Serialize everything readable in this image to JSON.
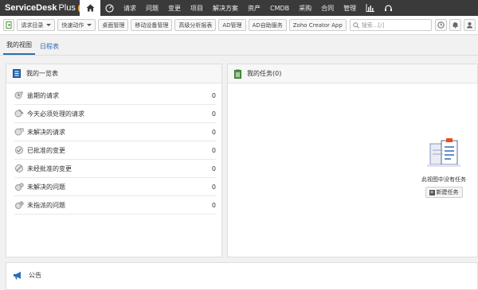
{
  "app": {
    "logo_text": "ServiceDesk",
    "logo_suffix": "Plus"
  },
  "nav": {
    "items": [
      "请求",
      "问题",
      "变更",
      "项目",
      "解决方案",
      "资产",
      "CMDB",
      "采购",
      "合同",
      "管理"
    ]
  },
  "toolbar": {
    "request_catalog": "请求目录",
    "quick_actions": "快速动作",
    "desktop_mgmt": "桌面管理",
    "mobile_mgmt": "移动设备管理",
    "advanced_reports": "高级分析报表",
    "ad_mgmt": "AD管理",
    "ad_selfservice": "AD自助服务",
    "zoho_creator": "Zoho Creator App",
    "search_placeholder": "搜索...[/]"
  },
  "tabs": [
    {
      "label": "我的视图",
      "active": true
    },
    {
      "label": "日程表",
      "active": false
    }
  ],
  "overview": {
    "title": "我的一览表",
    "rows": [
      {
        "label": "逾期的请求",
        "count": "0"
      },
      {
        "label": "今天必须处理的请求",
        "count": "0"
      },
      {
        "label": "未解决的请求",
        "count": "0"
      },
      {
        "label": "已批准的变更",
        "count": "0"
      },
      {
        "label": "未经批准的变更",
        "count": "0"
      },
      {
        "label": "未解决的问题",
        "count": "0"
      },
      {
        "label": "未指派的问题",
        "count": "0"
      }
    ]
  },
  "tasks": {
    "title": "我的任务(0)",
    "empty_text": "此视图中没有任务",
    "new_task": "新建任务"
  },
  "announcement": {
    "title": "公告"
  },
  "colors": {
    "nav_bg": "#3a3a3a",
    "accent": "#2c6db5"
  }
}
